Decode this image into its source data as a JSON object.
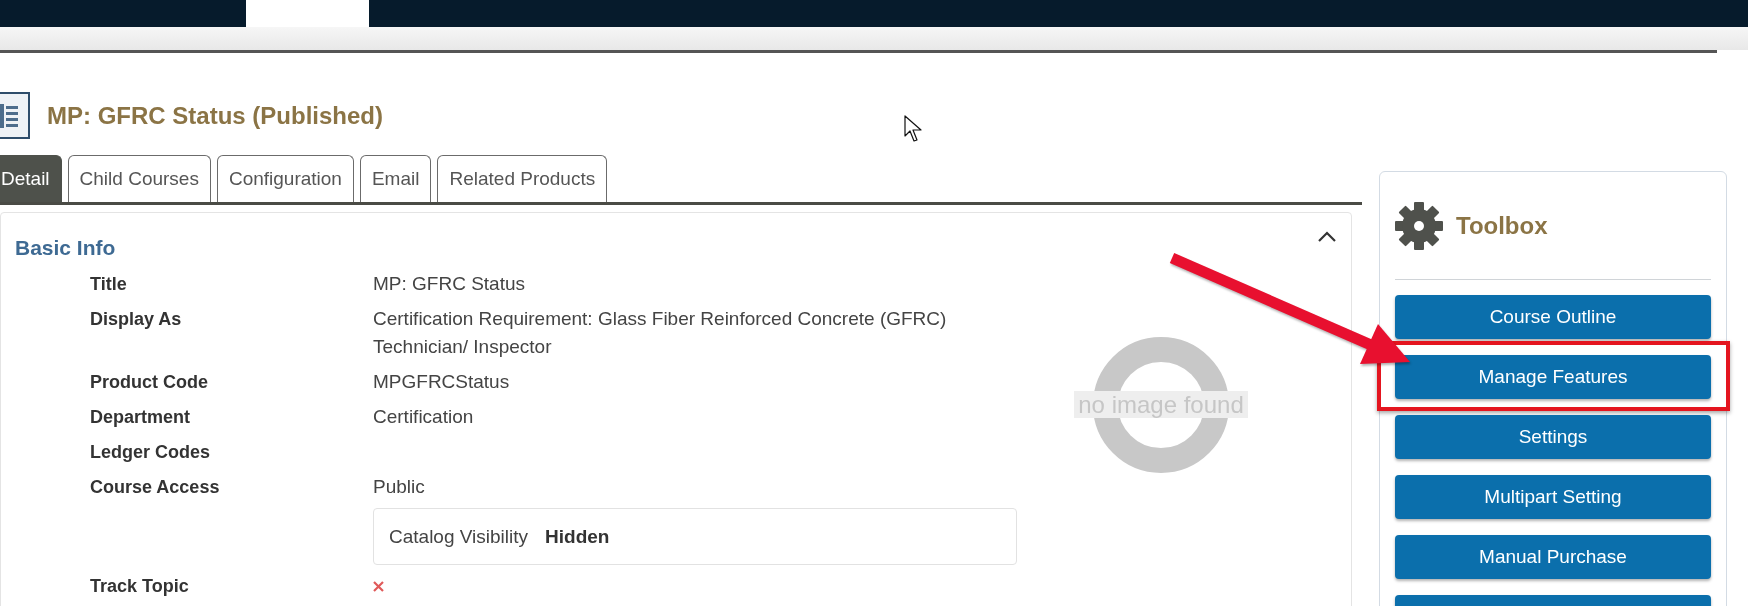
{
  "top_nav": {
    "tabs": [
      {
        "selected": true
      }
    ]
  },
  "page_title": "MP: GFRC Status (Published)",
  "tabs": [
    {
      "label": "Detail",
      "selected": true
    },
    {
      "label": "Child Courses",
      "selected": false
    },
    {
      "label": "Configuration",
      "selected": false
    },
    {
      "label": "Email",
      "selected": false
    },
    {
      "label": "Related Products",
      "selected": false
    }
  ],
  "basic_info": {
    "title": "Basic Info",
    "expanded": true,
    "fields": [
      {
        "kind": "text",
        "label": "Title",
        "value": "MP: GFRC Status"
      },
      {
        "kind": "text",
        "label": "Display As",
        "value": "Certification Requirement: Glass Fiber Reinforced Concrete (GFRC) Technician/ Inspector"
      },
      {
        "kind": "text",
        "label": "Product Code",
        "value": "MPGFRCStatus"
      },
      {
        "kind": "text",
        "label": "Department",
        "value": "Certification"
      },
      {
        "kind": "text",
        "label": "Ledger Codes"
      },
      {
        "kind": "text",
        "label": "Course Access",
        "value": "Public",
        "detail": {
          "label": "Catalog Visibility",
          "value": "Hidden"
        }
      },
      {
        "kind": "flag",
        "label": "Track Topic",
        "checked": false
      }
    ],
    "image_placeholder": {
      "text": "no image found"
    }
  },
  "toolbox": {
    "title": "Toolbox",
    "buttons": [
      {
        "label": "Course Outline",
        "highlighted": false
      },
      {
        "label": "Manage Features",
        "highlighted": true
      },
      {
        "label": "Settings",
        "highlighted": false
      },
      {
        "label": "Multipart Setting",
        "highlighted": false
      },
      {
        "label": "Manual Purchase",
        "highlighted": false
      },
      {
        "highlighted": false
      }
    ]
  }
}
